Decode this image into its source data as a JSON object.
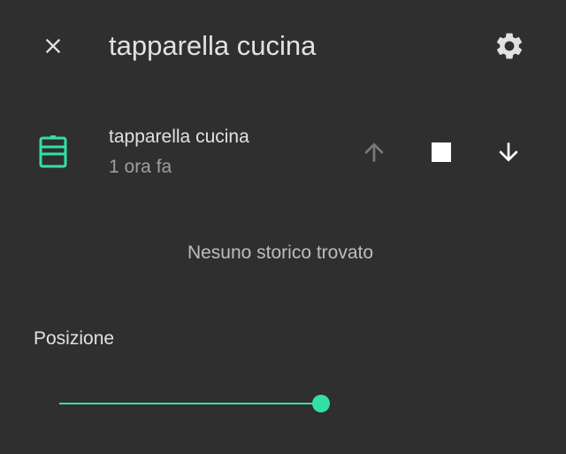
{
  "header": {
    "title": "tapparella cucina",
    "close_icon": "close-icon",
    "settings_icon": "gear-icon"
  },
  "entity": {
    "name": "tapparella cucina",
    "last_changed": "1 ora fa",
    "icon": "window-shutter-icon",
    "icon_color": "#33e0a4",
    "controls": {
      "open_icon": "arrow-up-icon",
      "stop_icon": "stop-icon",
      "close_icon": "arrow-down-icon"
    }
  },
  "history": {
    "empty_message": "Nesuno storico trovato"
  },
  "position": {
    "label": "Posizione",
    "value_percent": 100,
    "accent_color": "#33e0a4"
  }
}
